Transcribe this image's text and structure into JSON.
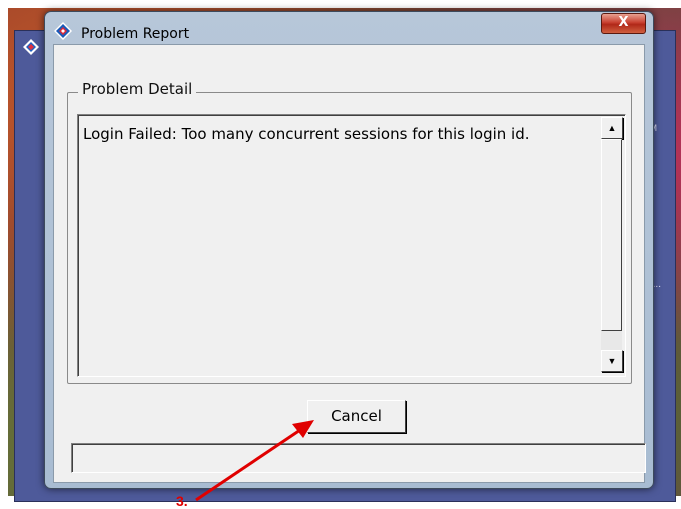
{
  "dialog": {
    "title": "Problem Report",
    "close_label": "X",
    "group_label": "Problem Detail",
    "message": "Login Failed: Too many concurrent sessions for this login id.",
    "cancel_label": "Cancel",
    "status_text": ""
  },
  "background": {
    "tm_text": "TM",
    "dots_text": "..."
  },
  "annotation": {
    "number": "3.",
    "color": "#e00000"
  },
  "icons": {
    "app": "diamond-app-icon",
    "scroll_up": "arrow-up-icon",
    "scroll_down": "arrow-down-icon"
  }
}
